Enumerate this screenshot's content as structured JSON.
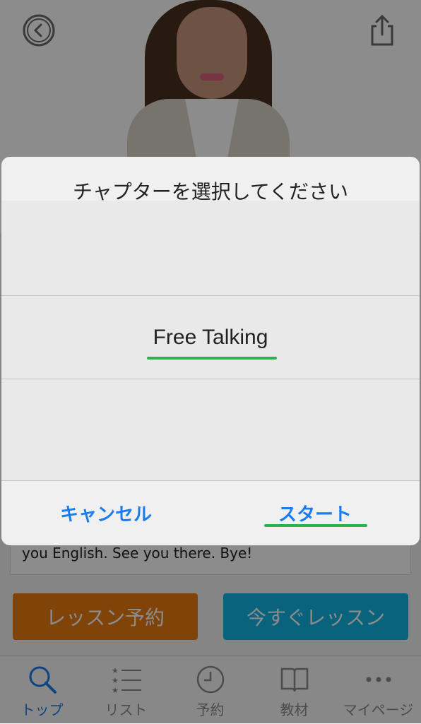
{
  "header": {
    "back_icon": "chevron-left-circle-icon",
    "share_icon": "share-icon"
  },
  "lesson": {
    "description_tail": "you English. See you there. Bye!",
    "reserve_label": "レッスン予約",
    "start_now_label": "今すぐレッスン"
  },
  "tabbar": {
    "items": [
      {
        "label": "トップ",
        "icon": "search-icon",
        "active": true
      },
      {
        "label": "リスト",
        "icon": "list-icon",
        "active": false
      },
      {
        "label": "予約",
        "icon": "clock-icon",
        "active": false
      },
      {
        "label": "教材",
        "icon": "book-icon",
        "active": false
      },
      {
        "label": "マイページ",
        "icon": "more-icon",
        "active": false
      }
    ]
  },
  "dialog": {
    "title": "チャプターを選択してください",
    "selected_option": "Free Talking",
    "cancel_label": "キャンセル",
    "start_label": "スタート"
  },
  "colors": {
    "accent_blue": "#1a7cf0",
    "reserve_orange": "#ea7a0f",
    "lesson_now_cyan": "#12b4e3",
    "highlight_green": "#2bb24c"
  }
}
